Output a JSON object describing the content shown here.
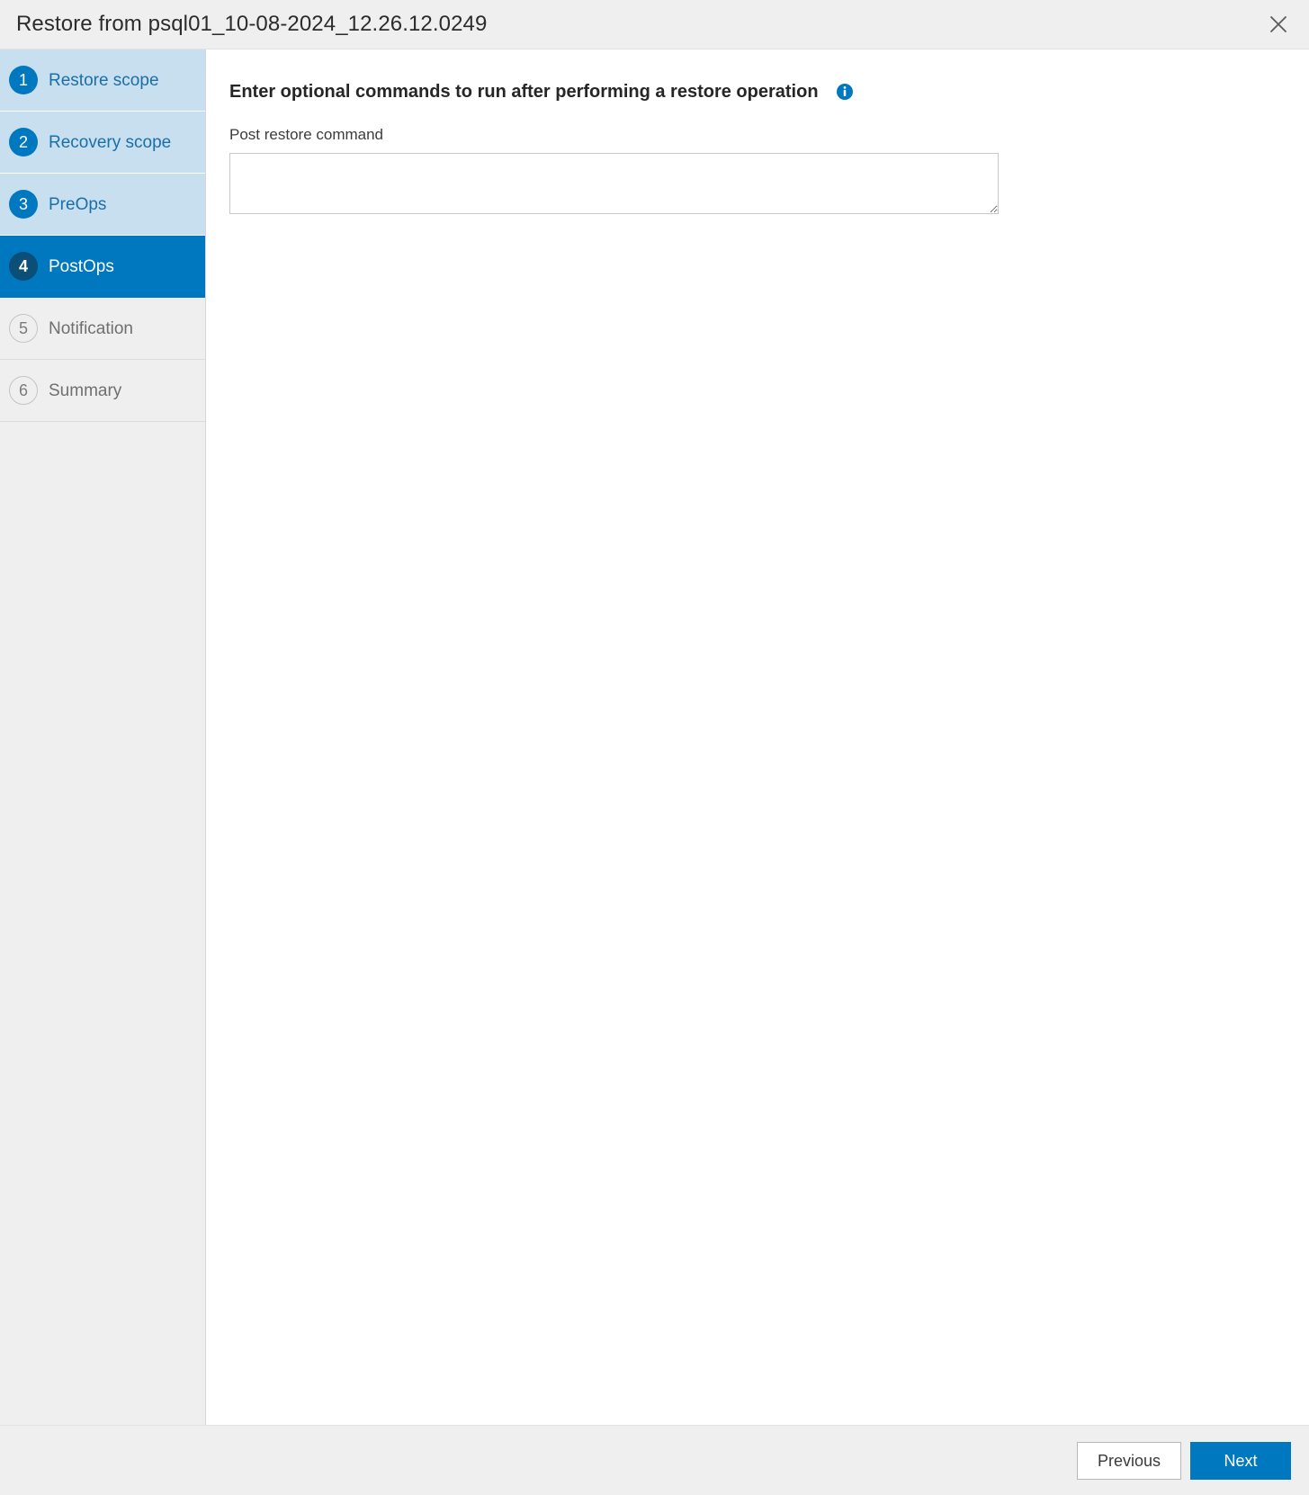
{
  "dialog": {
    "title": "Restore from psql01_10-08-2024_12.26.12.0249",
    "close_label": "Close",
    "close_icon": "close-icon"
  },
  "wizard": {
    "steps": [
      {
        "num": "1",
        "label": "Restore scope",
        "state": "completed"
      },
      {
        "num": "2",
        "label": "Recovery scope",
        "state": "completed"
      },
      {
        "num": "3",
        "label": "PreOps",
        "state": "completed"
      },
      {
        "num": "4",
        "label": "PostOps",
        "state": "active"
      },
      {
        "num": "5",
        "label": "Notification",
        "state": "pending"
      },
      {
        "num": "6",
        "label": "Summary",
        "state": "pending"
      }
    ]
  },
  "content": {
    "heading": "Enter optional commands to run after performing a restore operation",
    "info_icon": "info-icon",
    "field": {
      "label": "Post restore command",
      "value": "",
      "placeholder": ""
    }
  },
  "footer": {
    "previous_label": "Previous",
    "next_label": "Next"
  },
  "colors": {
    "accent": "#0078bf",
    "accent_dark": "#0b4f78",
    "completed_bg": "#c7dfef",
    "panel_bg": "#efefef",
    "text": "#2c2c2c",
    "muted_text": "#6f6f6f"
  }
}
